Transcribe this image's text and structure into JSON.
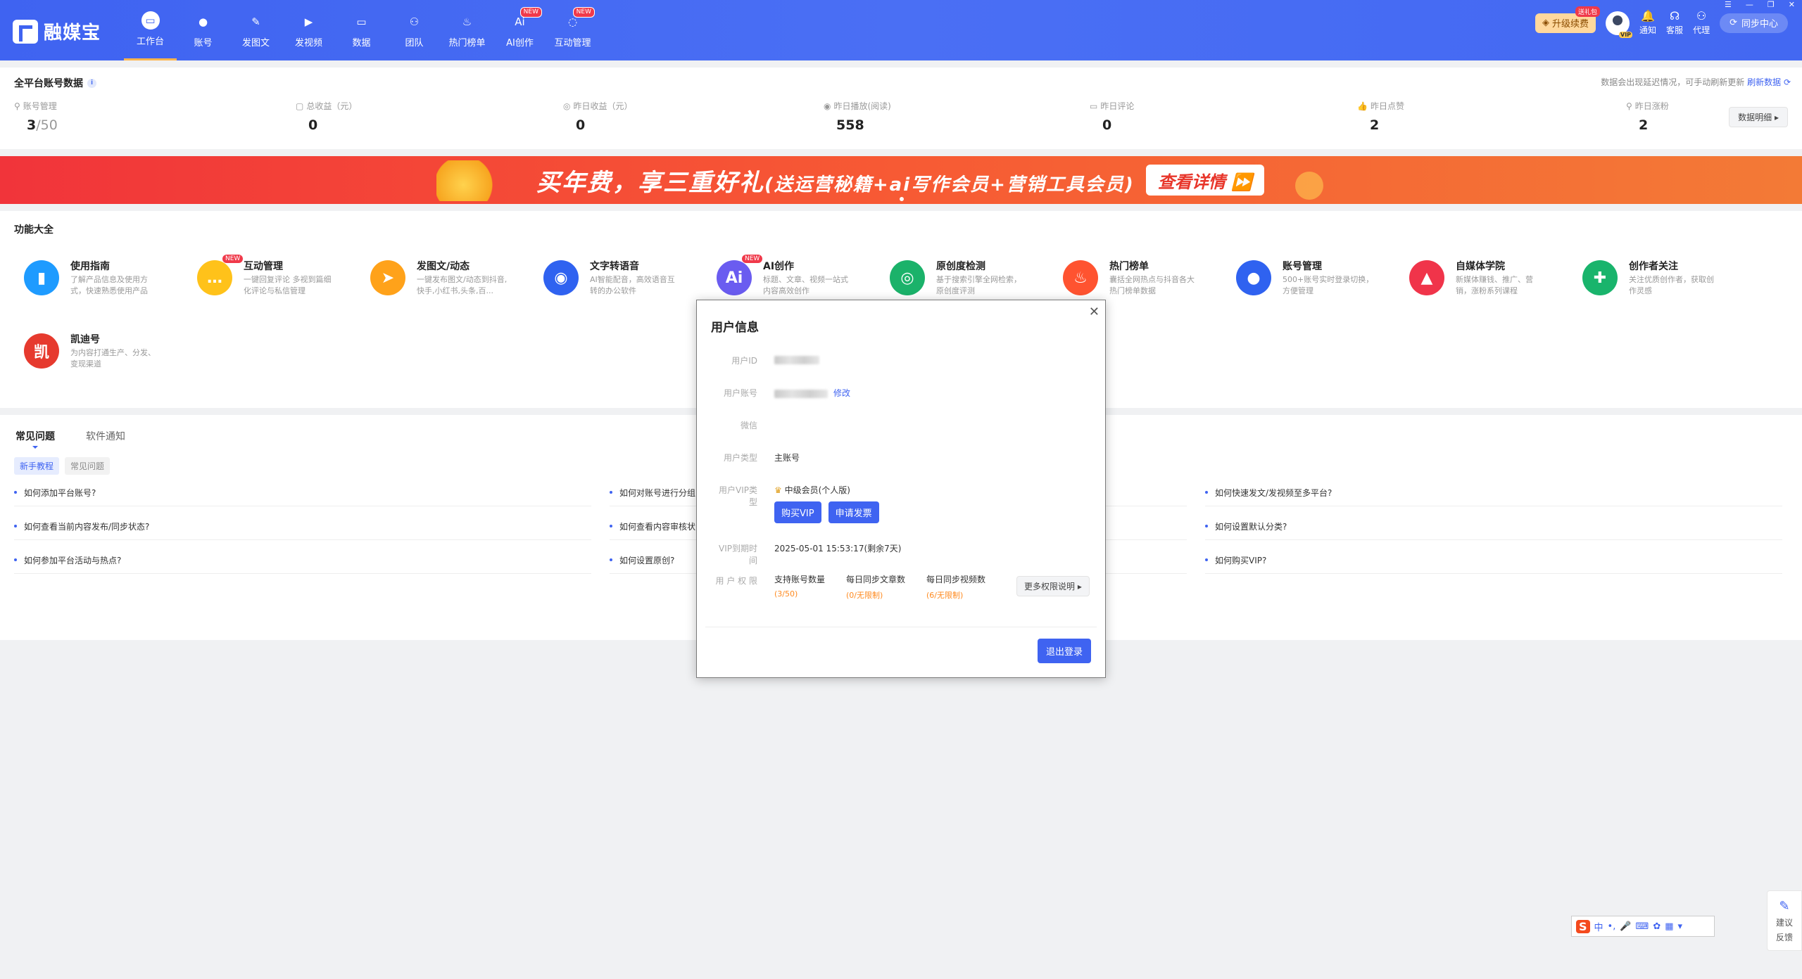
{
  "app": {
    "name": "融媒宝"
  },
  "nav": [
    {
      "label": "工作台",
      "icon": "workbench-icon",
      "active": true
    },
    {
      "label": "账号",
      "icon": "account-icon"
    },
    {
      "label": "发图文",
      "icon": "publish-post-icon"
    },
    {
      "label": "发视频",
      "icon": "publish-video-icon"
    },
    {
      "label": "数据",
      "icon": "data-icon"
    },
    {
      "label": "团队",
      "icon": "team-icon"
    },
    {
      "label": "热门榜单",
      "icon": "hot-list-icon"
    },
    {
      "label": "AI创作",
      "icon": "ai-icon",
      "badge": "NEW"
    },
    {
      "label": "互动管理",
      "icon": "interaction-icon",
      "badge": "NEW"
    }
  ],
  "topright": {
    "upgrade_label": "升级续费",
    "upgrade_badge": "送礼包",
    "avatar_badge": "VIP",
    "notify": "通知",
    "service": "客服",
    "agent": "代理",
    "sync": "同步中心"
  },
  "stats": {
    "title": "全平台账号数据",
    "note": "数据会出现延迟情况，可手动刷新更新",
    "refresh": "刷新数据",
    "detail": "数据明细",
    "items": [
      {
        "label": "账号管理",
        "value": "3",
        "sub": "/50"
      },
      {
        "label": "总收益（元）",
        "value": "0"
      },
      {
        "label": "昨日收益（元）",
        "value": "0"
      },
      {
        "label": "昨日播放(阅读)",
        "value": "558"
      },
      {
        "label": "昨日评论",
        "value": "0"
      },
      {
        "label": "昨日点赞",
        "value": "2"
      },
      {
        "label": "昨日涨粉",
        "value": "2"
      }
    ]
  },
  "banner": {
    "text": "买年费，享三重好礼",
    "sub": "(送运营秘籍+ai写作会员+营销工具会员)",
    "button": "查看详情 ⏩"
  },
  "features": {
    "title": "功能大全",
    "items": [
      {
        "title": "使用指南",
        "desc": "了解产品信息及使用方式，快速熟悉使用产品",
        "color": "#1e9bff",
        "glyph": "▮"
      },
      {
        "title": "互动管理",
        "desc": "一键回复评论 多视到篇细化评论与私信管理",
        "color": "#ffc21a",
        "glyph": "…",
        "badge": "NEW"
      },
      {
        "title": "发图文/动态",
        "desc": "一键发布图文/动态到抖音,快手,小红书,头条,百...",
        "color": "#ffa21a",
        "glyph": "➤"
      },
      {
        "title": "文字转语音",
        "desc": "AI智能配音，高效语音互转的办公软件",
        "color": "#2f62f0",
        "glyph": "◉"
      },
      {
        "title": "AI创作",
        "desc": "标题、文章、视频一站式内容高效创作",
        "color": "#6a5cf0",
        "glyph": "Ai",
        "badge": "NEW"
      },
      {
        "title": "原创度检测",
        "desc": "基于搜索引擎全网检索，原创度评测",
        "color": "#1bb26a",
        "glyph": "◎"
      },
      {
        "title": "热门榜单",
        "desc": "囊括全网热点与抖音各大热门榜单数据",
        "color": "#ff5330",
        "glyph": "♨"
      },
      {
        "title": "账号管理",
        "desc": "500+账号实时登录切换，方便管理",
        "color": "#2f62f0",
        "glyph": "●"
      },
      {
        "title": "自媒体学院",
        "desc": "新媒体赚钱、推广、营销，涨粉系列课程",
        "color": "#f0344a",
        "glyph": "▲"
      },
      {
        "title": "创作者关注",
        "desc": "关注优质创作者，获取创作灵感",
        "color": "#19b46c",
        "glyph": "✚"
      },
      {
        "title": "凯迪号",
        "desc": "为内容打通生产、分发、变现渠道",
        "color": "#e63a2e",
        "glyph": "凯"
      }
    ]
  },
  "faq": {
    "tabs": [
      "常见问题",
      "软件通知"
    ],
    "chips": [
      "新手教程",
      "常见问题"
    ],
    "items": [
      "如何添加平台账号?",
      "如何对账号进行分组",
      "如何快速发文/发视频至多平台?",
      "如何查看当前内容发布/同步状态?",
      "如何查看内容审核状",
      "如何设置默认分类?",
      "如何参加平台活动与热点?",
      "如何设置原创?",
      "如何购买VIP?"
    ]
  },
  "modal": {
    "title": "用户信息",
    "labels": {
      "id": "用户ID",
      "account": "用户账号",
      "wechat": "微信",
      "type": "用户类型",
      "vip": "用户VIP类型",
      "expire": "VIP到期时间",
      "rights": "用 户 权 限"
    },
    "edit": "修改",
    "type_value": "主账号",
    "vip_value": "中级会员(个人版)",
    "buy": "购买VIP",
    "invoice": "申请发票",
    "expire_value": "2025-05-01 15:53:17(剩余7天)",
    "perms": [
      {
        "label": "支持账号数量",
        "value": "(3/50)"
      },
      {
        "label": "每日同步文章数",
        "value": "(0/无限制)"
      },
      {
        "label": "每日同步视频数",
        "value": "(6/无限制)"
      }
    ],
    "more": "更多权限说明 ▸",
    "logout": "退出登录"
  },
  "feedback": {
    "line1": "建议",
    "line2": "反馈"
  },
  "ime": {
    "logo": "S",
    "lang": "中"
  }
}
